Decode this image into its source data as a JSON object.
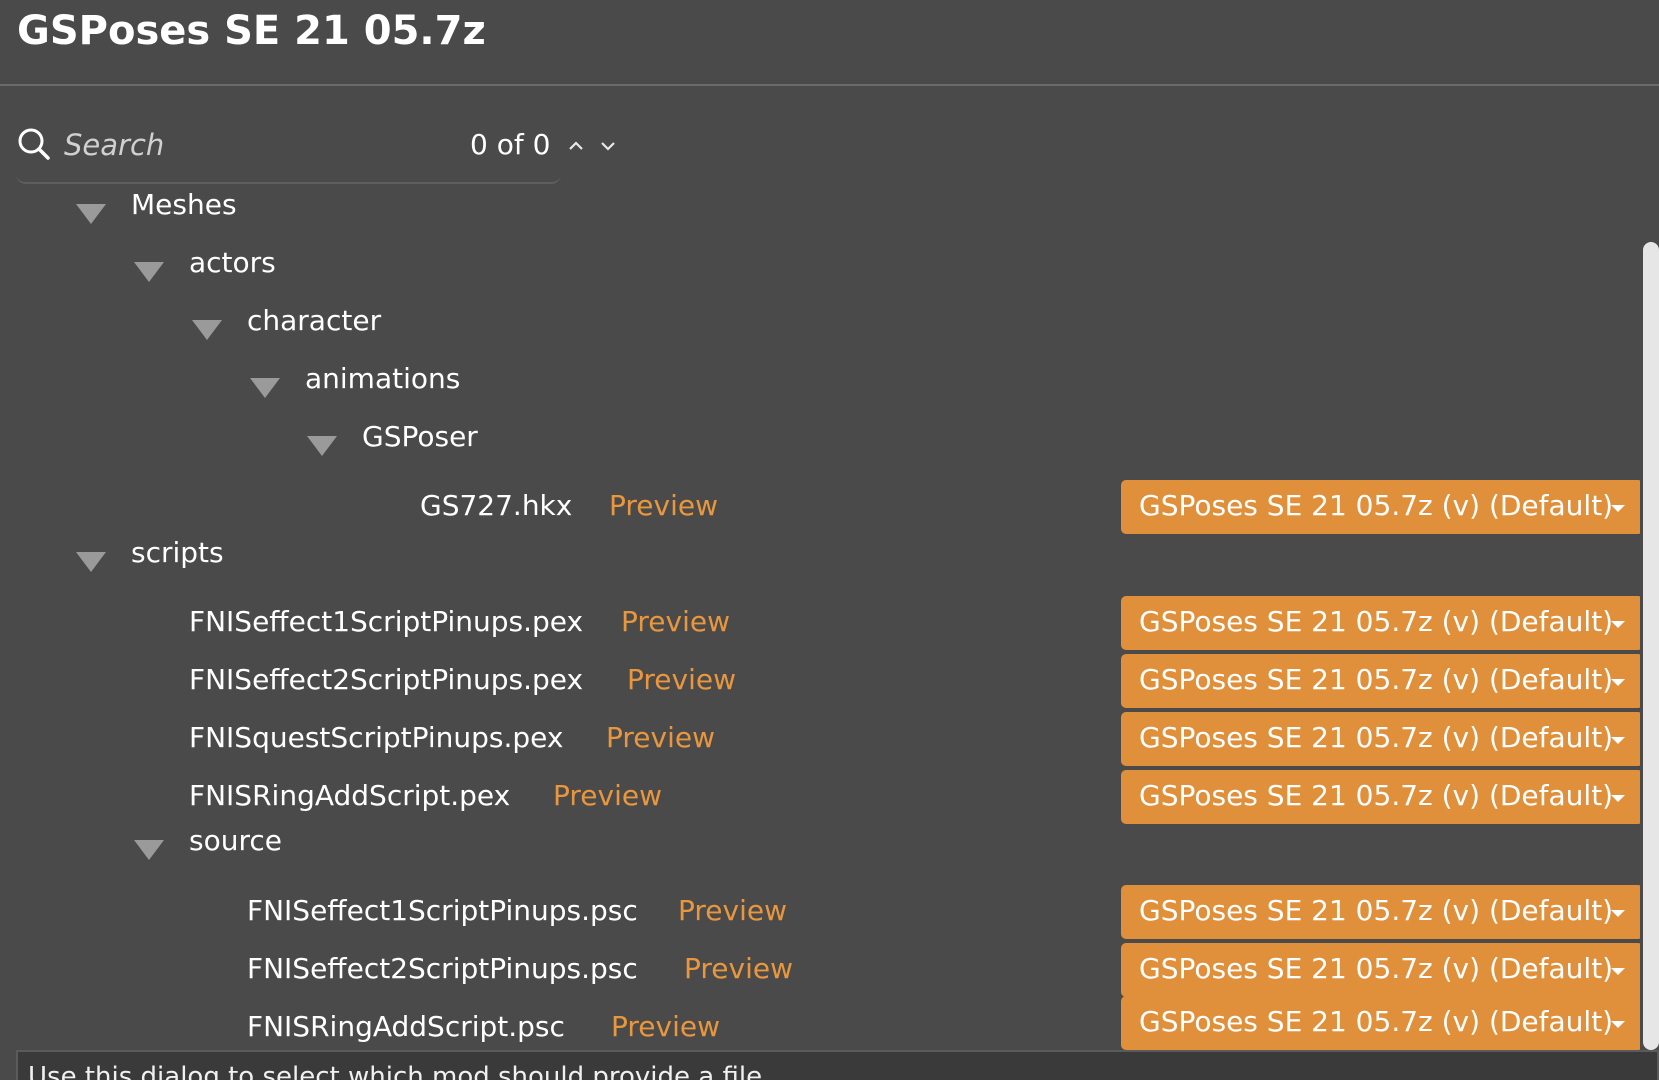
{
  "window": {
    "title": "GSPoses SE 21 05.7z"
  },
  "search": {
    "placeholder": "Search",
    "value": "",
    "match_count": "0 of 0"
  },
  "tree": {
    "folders": {
      "meshes": "Meshes",
      "actors": "actors",
      "character": "character",
      "animations": "animations",
      "gsposer": "GSPoser",
      "scripts": "scripts",
      "source": "source"
    },
    "files": [
      {
        "name": "GS727.hkx",
        "preview": "Preview",
        "provider": "GSPoses SE 21 05.7z (v) (Default)"
      },
      {
        "name": "FNISeffect1ScriptPinups.pex",
        "preview": "Preview",
        "provider": "GSPoses SE 21 05.7z (v) (Default)"
      },
      {
        "name": "FNISeffect2ScriptPinups.pex",
        "preview": "Preview",
        "provider": "GSPoses SE 21 05.7z (v) (Default)"
      },
      {
        "name": "FNISquestScriptPinups.pex",
        "preview": "Preview",
        "provider": "GSPoses SE 21 05.7z (v) (Default)"
      },
      {
        "name": "FNISRingAddScript.pex",
        "preview": "Preview",
        "provider": "GSPoses SE 21 05.7z (v) (Default)"
      },
      {
        "name": "FNISeffect1ScriptPinups.psc",
        "preview": "Preview",
        "provider": "GSPoses SE 21 05.7z (v) (Default)"
      },
      {
        "name": "FNISeffect2ScriptPinups.psc",
        "preview": "Preview",
        "provider": "GSPoses SE 21 05.7z (v) (Default)"
      },
      {
        "name": "FNISRingAddScript.psc",
        "preview": "Preview",
        "provider": "GSPoses SE 21 05.7z (v) (Default)"
      }
    ]
  },
  "help": {
    "text": "Use this dialog to select which mod should provide a file."
  },
  "colors": {
    "background": "#4a4a4a",
    "accent": "#e08f3a",
    "preview_link": "#e8973e",
    "text": "#ffffff"
  },
  "icons": {
    "search": "search-icon",
    "up": "chevron-up-icon",
    "down": "chevron-down-icon",
    "expand": "triangle-down-icon"
  }
}
